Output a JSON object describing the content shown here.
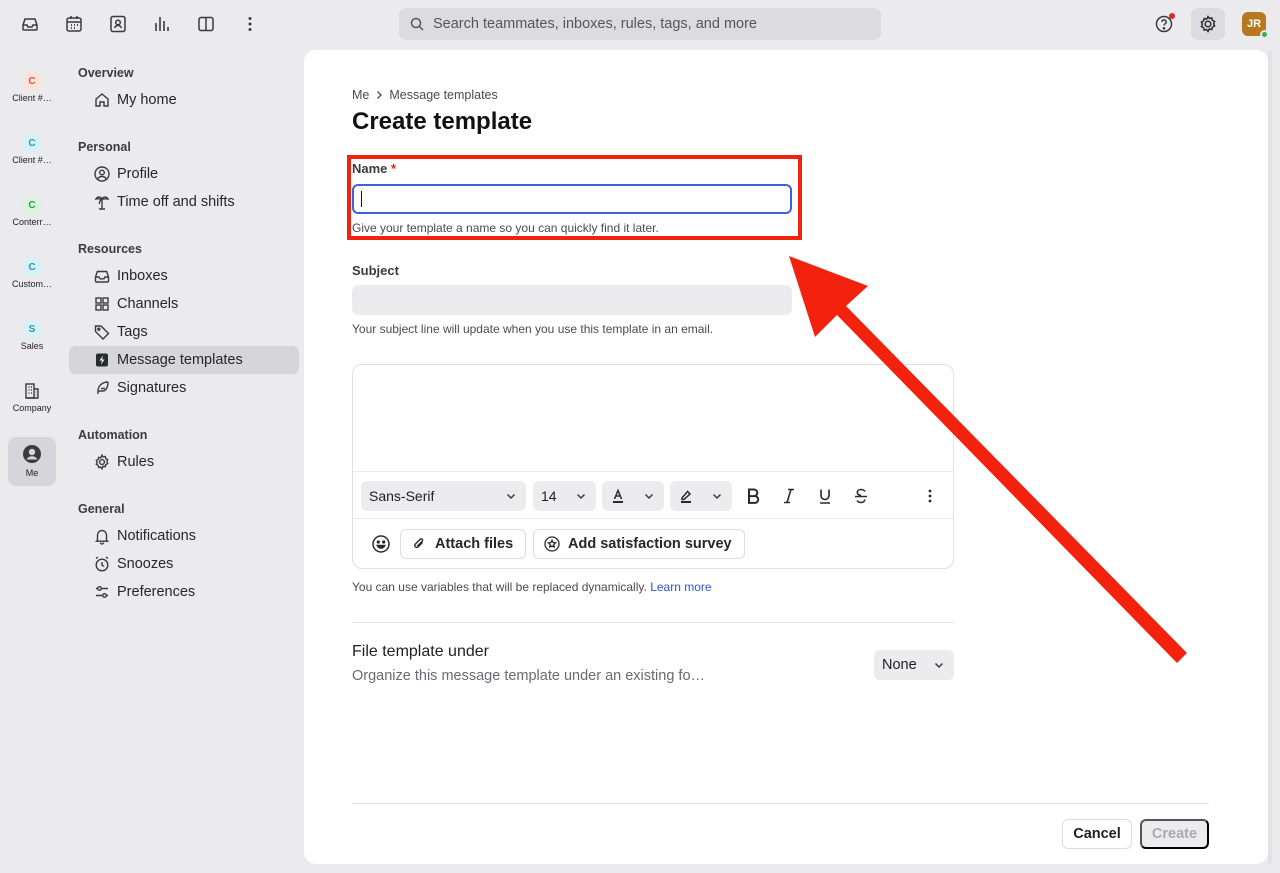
{
  "topbar": {
    "search_placeholder": "Search teammates, inboxes, rules, tags, and more",
    "avatar_initials": "JR"
  },
  "rail": [
    {
      "badge": "C",
      "label": "Client #…",
      "bg": "#fde3dc",
      "fg": "#e2553a"
    },
    {
      "badge": "C",
      "label": "Client #…",
      "bg": "#d7f1f6",
      "fg": "#2a98b5"
    },
    {
      "badge": "C",
      "label": "Conterr…",
      "bg": "#dcf2df",
      "fg": "#2f9b4a"
    },
    {
      "badge": "C",
      "label": "Custom…",
      "bg": "#d7f1f6",
      "fg": "#2a98b5"
    },
    {
      "badge": "S",
      "label": "Sales",
      "bg": "#d7f1f6",
      "fg": "#2a98b5"
    },
    {
      "badge": "",
      "label": "Company",
      "bg": "",
      "fg": ""
    },
    {
      "badge": "",
      "label": "Me",
      "bg": "",
      "fg": ""
    }
  ],
  "sidebar": {
    "overview": "Overview",
    "my_home": "My home",
    "personal": "Personal",
    "profile": "Profile",
    "time_off": "Time off and shifts",
    "resources": "Resources",
    "inboxes": "Inboxes",
    "channels": "Channels",
    "tags": "Tags",
    "message_templates": "Message templates",
    "signatures": "Signatures",
    "automation": "Automation",
    "rules": "Rules",
    "general": "General",
    "notifications": "Notifications",
    "snoozes": "Snoozes",
    "preferences": "Preferences"
  },
  "main": {
    "breadcrumb_root": "Me",
    "breadcrumb_current": "Message templates",
    "title": "Create template",
    "name_label": "Name",
    "required_mark": "*",
    "name_value": "",
    "name_hint": "Give your template a name so you can quickly find it later.",
    "subject_label": "Subject",
    "subject_value": "",
    "subject_hint": "Your subject line will update when you use this template in an email.",
    "font_family": "Sans-Serif",
    "font_size": "14",
    "attach_files": "Attach files",
    "add_survey": "Add satisfaction survey",
    "variables_hint": "You can use variables that will be replaced dynamically.",
    "learn_more": "Learn more",
    "file_under_title": "File template under",
    "file_under_desc": "Organize this message template under an existing fo…",
    "file_under_value": "None",
    "cancel": "Cancel",
    "create": "Create"
  },
  "colors": {
    "accent": "#3f5fe0",
    "annotation": "#f3220e",
    "link": "#2c55d8"
  }
}
